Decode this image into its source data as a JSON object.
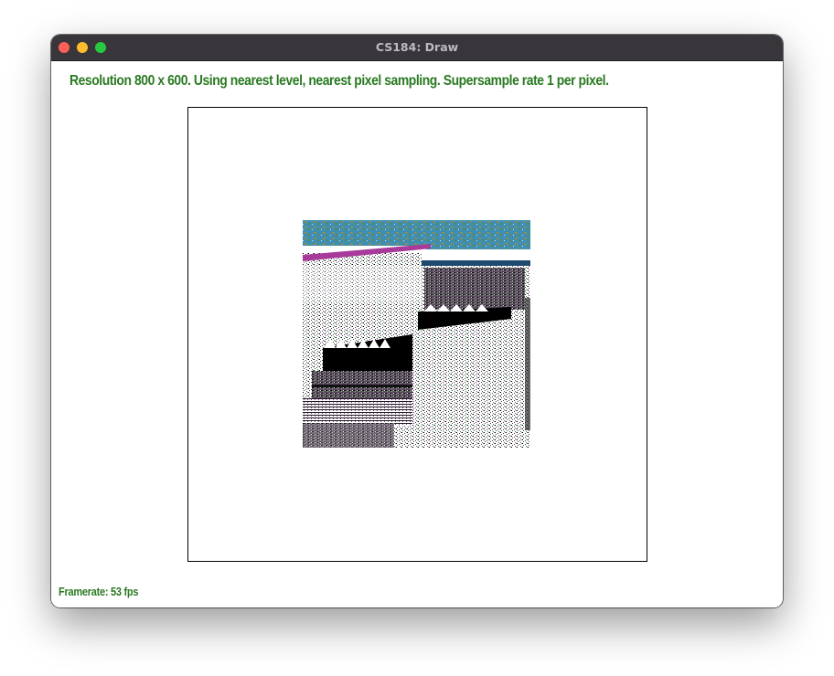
{
  "window": {
    "title": "CS184: Draw"
  },
  "status": {
    "text": "Resolution 800 x 600. Using nearest level, nearest pixel sampling. Supersample rate 1 per pixel."
  },
  "footer": {
    "framerate": "Framerate: 53 fps"
  },
  "colors": {
    "status_text": "#2a7a22",
    "titlebar": "#38363b",
    "close": "#ff5f57",
    "minimize": "#febc2e",
    "maximize": "#28c840"
  },
  "icons": {
    "close": "close-dot-icon",
    "minimize": "minimize-dot-icon",
    "maximize": "maximize-dot-icon"
  }
}
